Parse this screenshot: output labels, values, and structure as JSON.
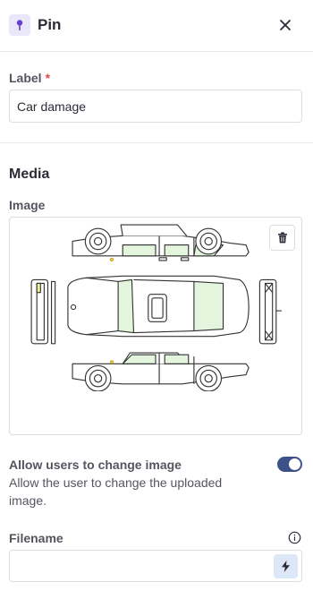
{
  "header": {
    "title": "Pin",
    "icon": "pin-icon",
    "close_icon": "close-icon"
  },
  "label_field": {
    "label": "Label",
    "required_mark": "*",
    "value": "Car damage"
  },
  "media": {
    "section_title": "Media",
    "image_label": "Image",
    "image_alt": "Car damage diagram showing vehicle from top, sides, front and back",
    "delete_icon": "trash-icon"
  },
  "allow_change": {
    "title": "Allow users to change image",
    "description": "Allow the user to change the uploaded image.",
    "enabled": true
  },
  "filename": {
    "label": "Filename",
    "value": "",
    "info_icon": "info-icon",
    "action_icon": "lightning-icon"
  },
  "colors": {
    "accent": "#3c5189",
    "pin_badge_bg": "#ebe7fb",
    "pin_color": "#6a3fd1",
    "required": "#e5484d",
    "window_tint": "#e3f5dc",
    "bolt_bg": "#dce8f8"
  }
}
